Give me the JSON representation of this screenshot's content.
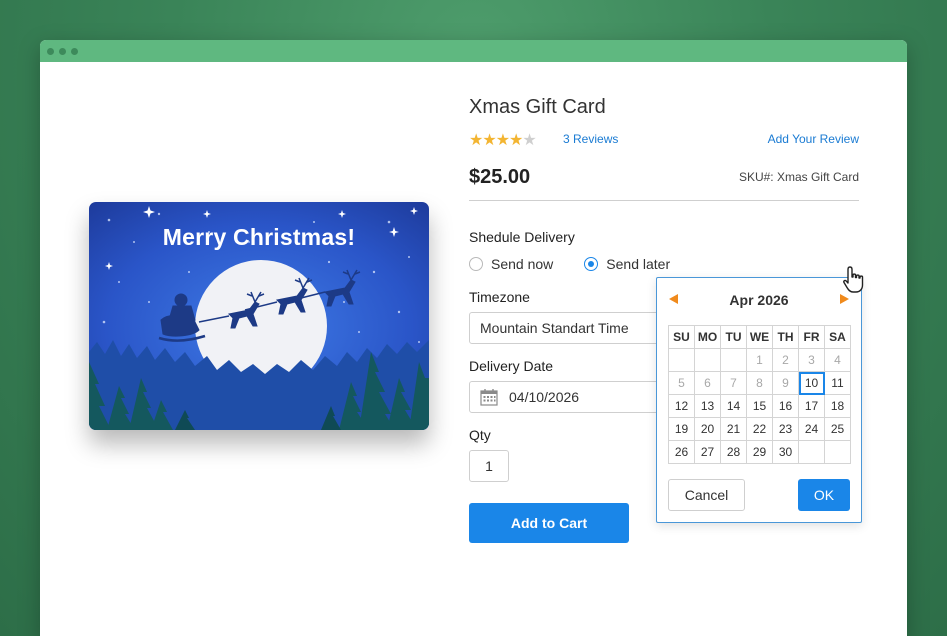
{
  "product": {
    "title": "Xmas Gift Card",
    "rating": 4,
    "rating_max": 5,
    "reviews_link": "3 Reviews",
    "add_review": "Add Your Review",
    "price": "$25.00",
    "sku": "SKU#: Xmas Gift Card"
  },
  "card_image": {
    "greeting": "Merry Christmas!"
  },
  "delivery": {
    "schedule_label": "Shedule Delivery",
    "option_now": "Send now",
    "option_later": "Send later",
    "selected_option": "Send later",
    "timezone_label": "Timezone",
    "timezone_value": "Mountain Standart Time",
    "date_label": "Delivery Date",
    "date_value": "04/10/2026"
  },
  "qty": {
    "label": "Qty",
    "value": "1"
  },
  "add_to_cart": "Add to Cart",
  "calendar": {
    "month_label": "Apr 2026",
    "weekdays": [
      "SU",
      "MO",
      "TU",
      "WE",
      "TH",
      "FR",
      "SA"
    ],
    "weeks": [
      [
        "",
        "",
        "",
        "1",
        "2",
        "3",
        "4"
      ],
      [
        "5",
        "6",
        "7",
        "8",
        "9",
        "10",
        "11"
      ],
      [
        "12",
        "13",
        "14",
        "15",
        "16",
        "17",
        "18"
      ],
      [
        "19",
        "20",
        "21",
        "22",
        "23",
        "24",
        "25"
      ],
      [
        "26",
        "27",
        "28",
        "29",
        "30",
        "",
        ""
      ]
    ],
    "past_days": [
      "1",
      "2",
      "3",
      "4",
      "5",
      "6",
      "7",
      "8",
      "9"
    ],
    "selected_day": "10",
    "cancel_label": "Cancel",
    "ok_label": "OK"
  },
  "colors": {
    "accent": "#1a86e8",
    "link": "#1a7bd3",
    "star": "#f3b532",
    "nav_arrow": "#f08a1c",
    "titlebar": "#5fb880",
    "background": "#3a8458"
  }
}
